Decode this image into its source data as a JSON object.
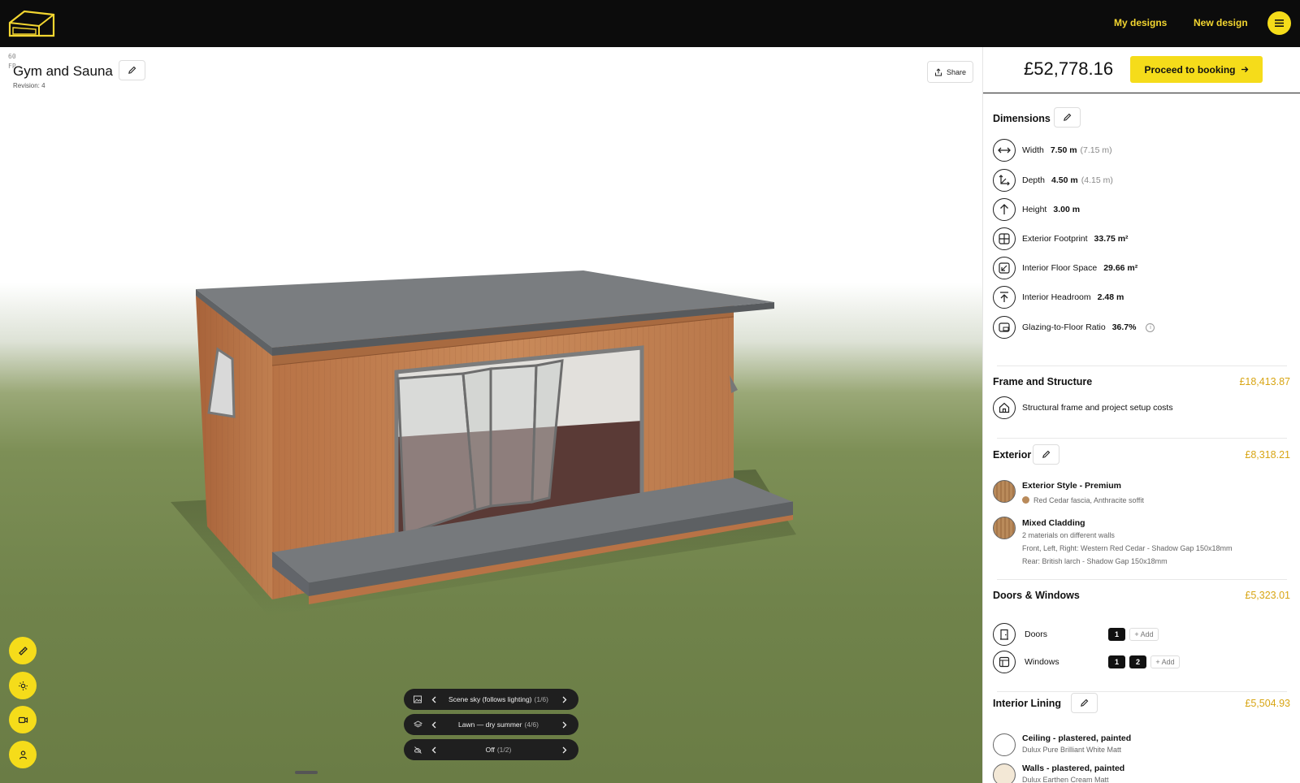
{
  "header": {
    "nav": {
      "my_designs": "My designs",
      "new_design": "New design"
    }
  },
  "viewport": {
    "fps_value": "60",
    "fps_label": "FP",
    "design_title": "Gym and Sauna",
    "revision": "Revision: 4",
    "share_label": "Share",
    "scene_controls": [
      {
        "label": "Scene sky (follows lighting)",
        "count": "(1/6)",
        "icon": "image-icon"
      },
      {
        "label": "Lawn — dry summer",
        "count": "(4/6)",
        "icon": "layers-icon"
      },
      {
        "label": "Off",
        "count": "(1/2)",
        "icon": "weather-off-icon"
      }
    ],
    "tools": [
      "ruler-icon",
      "sun-icon",
      "camera-icon",
      "person-icon"
    ]
  },
  "sidebar": {
    "total_price": "£52,778.16",
    "book_label": "Proceed to booking",
    "dimensions": {
      "title": "Dimensions",
      "rows": [
        {
          "label": "Width",
          "value": "7.50 m",
          "sub": "(7.15 m)",
          "icon": "width-arrows-icon"
        },
        {
          "label": "Depth",
          "value": "4.50 m",
          "sub": "(4.15 m)",
          "icon": "depth-axes-icon"
        },
        {
          "label": "Height",
          "value": "3.00 m",
          "sub": "",
          "icon": "arrow-up-icon"
        },
        {
          "label": "Exterior Footprint",
          "value": "33.75 m²",
          "sub": "",
          "icon": "grid-square-icon"
        },
        {
          "label": "Interior Floor Space",
          "value": "29.66 m²",
          "sub": "",
          "icon": "resize-diagonal-icon"
        },
        {
          "label": "Interior Headroom",
          "value": "2.48 m",
          "sub": "",
          "icon": "arrow-to-top-icon"
        },
        {
          "label": "Glazing-to-Floor Ratio",
          "value": "36.7%",
          "sub": "",
          "icon": "window-icon"
        }
      ]
    },
    "frame": {
      "title": "Frame and Structure",
      "price": "£18,413.87",
      "item": "Structural frame and project setup costs"
    },
    "exterior": {
      "title": "Exterior",
      "price": "£8,318.21",
      "style_title": "Exterior Style - Premium",
      "style_sub": "Red Cedar fascia, Anthracite soffit",
      "cladding_title": "Mixed Cladding",
      "cladding_sub": "2 materials on different walls",
      "cladding_line1": "Front, Left, Right: Western Red Cedar - Shadow Gap 150x18mm",
      "cladding_line2": "Rear: British larch - Shadow Gap 150x18mm"
    },
    "doors_windows": {
      "title": "Doors & Windows",
      "price": "£5,323.01",
      "doors_label": "Doors",
      "doors_counts": [
        "1"
      ],
      "windows_label": "Windows",
      "windows_counts": [
        "1",
        "2"
      ],
      "add_label": "+ Add"
    },
    "interior": {
      "title": "Interior Lining",
      "price": "£5,504.93",
      "ceiling_title": "Ceiling - plastered, painted",
      "ceiling_sub": "Dulux Pure Brilliant White Matt",
      "walls_title": "Walls - plastered, painted",
      "walls_sub": "Dulux Earthen Cream Matt"
    },
    "colors": {
      "accent": "#f5dc1a",
      "price_gold": "#d8a514"
    }
  }
}
